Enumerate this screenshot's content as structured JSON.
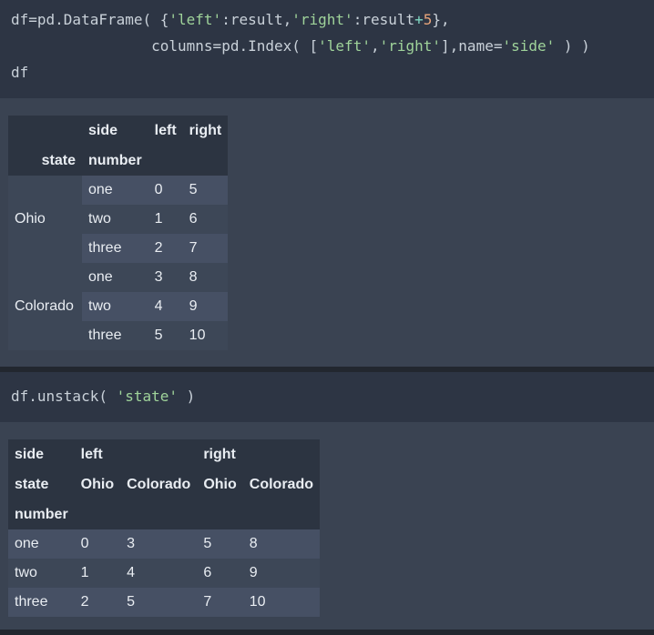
{
  "code1": {
    "line1": {
      "a": "df=pd.DataFrame( {",
      "s1": "'left'",
      "b": ":result,",
      "s2": "'right'",
      "c": ":result",
      "op": "+",
      "n": "5",
      "d": "},"
    },
    "line2": {
      "pad": "                columns=pd.Index( [",
      "s1": "'left'",
      "b": ",",
      "s2": "'right'",
      "c": "],name=",
      "s3": "'side'",
      "d": " ) )"
    },
    "line3": "df"
  },
  "table1": {
    "header1": [
      "",
      "side",
      "left",
      "right"
    ],
    "header2": [
      "state",
      "number",
      "",
      ""
    ],
    "groups": [
      {
        "label": "Ohio",
        "rows": [
          [
            "one",
            "0",
            "5"
          ],
          [
            "two",
            "1",
            "6"
          ],
          [
            "three",
            "2",
            "7"
          ]
        ]
      },
      {
        "label": "Colorado",
        "rows": [
          [
            "one",
            "3",
            "8"
          ],
          [
            "two",
            "4",
            "9"
          ],
          [
            "three",
            "5",
            "10"
          ]
        ]
      }
    ]
  },
  "code2": {
    "a": "df.unstack( ",
    "s": "'state'",
    "b": " )"
  },
  "table2": {
    "header1": [
      "side",
      "left",
      "",
      "right",
      ""
    ],
    "header2": [
      "state",
      "Ohio",
      "Colorado",
      "Ohio",
      "Colorado"
    ],
    "header3": [
      "number",
      "",
      "",
      "",
      ""
    ],
    "rows": [
      [
        "one",
        "0",
        "3",
        "5",
        "8"
      ],
      [
        "two",
        "1",
        "4",
        "6",
        "9"
      ],
      [
        "three",
        "2",
        "5",
        "7",
        "10"
      ]
    ]
  }
}
